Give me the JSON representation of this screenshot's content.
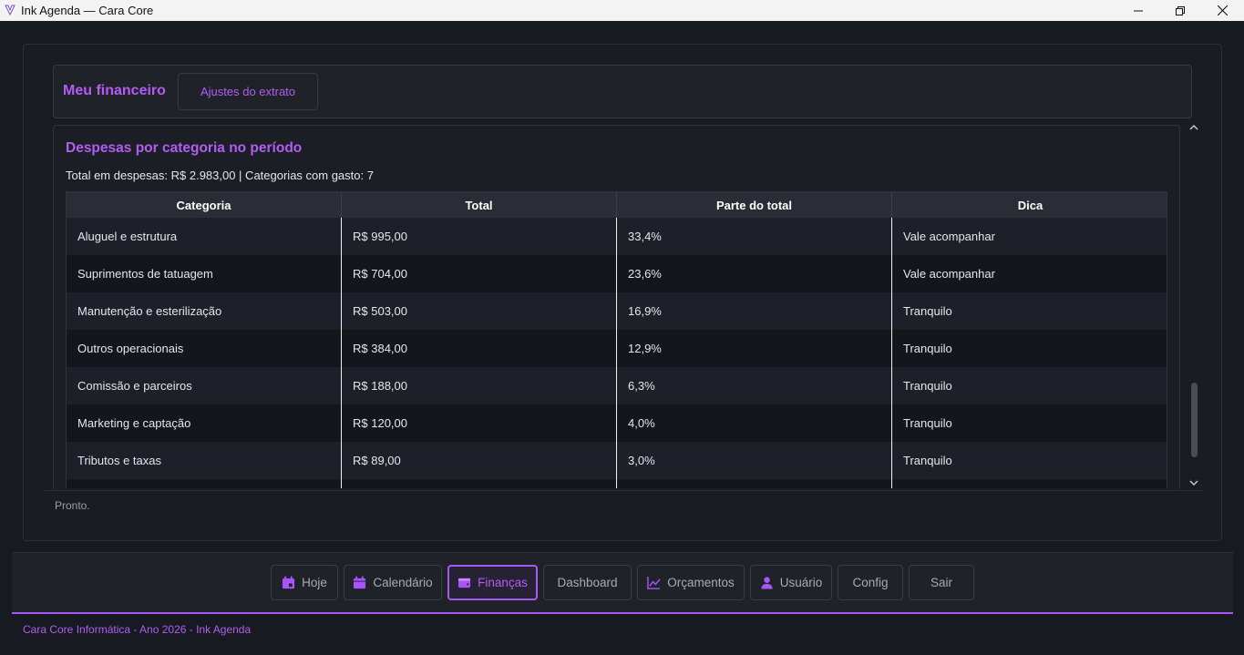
{
  "window": {
    "title": "Ink Agenda — Cara Core"
  },
  "header": {
    "brand": "Meu financeiro",
    "tab_label": "Ajustes do extrato"
  },
  "section": {
    "title": "Despesas por categoria no período",
    "summary": "Total em despesas: R$ 2.983,00 | Categorias com gasto: 7"
  },
  "table": {
    "columns": [
      "Categoria",
      "Total",
      "Parte do total",
      "Dica"
    ],
    "rows": [
      [
        "Aluguel e estrutura",
        "R$ 995,00",
        "33,4%",
        "Vale acompanhar"
      ],
      [
        "Suprimentos de tatuagem",
        "R$ 704,00",
        "23,6%",
        "Vale acompanhar"
      ],
      [
        "Manutenção e esterilização",
        "R$ 503,00",
        "16,9%",
        "Tranquilo"
      ],
      [
        "Outros operacionais",
        "R$ 384,00",
        "12,9%",
        "Tranquilo"
      ],
      [
        "Comissão e parceiros",
        "R$ 188,00",
        "6,3%",
        "Tranquilo"
      ],
      [
        "Marketing e captação",
        "R$ 120,00",
        "4,0%",
        "Tranquilo"
      ],
      [
        "Tributos e taxas",
        "R$ 89,00",
        "3,0%",
        "Tranquilo"
      ],
      [
        "",
        "",
        "",
        ""
      ]
    ]
  },
  "status": "Pronto.",
  "nav": {
    "items": [
      {
        "label": "Hoje",
        "icon": "calendar-day-icon"
      },
      {
        "label": "Calendário",
        "icon": "calendar-icon"
      },
      {
        "label": "Finanças",
        "icon": "wallet-icon",
        "active": true
      },
      {
        "label": "Dashboard",
        "icon": ""
      },
      {
        "label": "Orçamentos",
        "icon": "chart-line-icon"
      },
      {
        "label": "Usuário",
        "icon": "user-icon"
      },
      {
        "label": "Config",
        "icon": ""
      },
      {
        "label": "Sair",
        "icon": ""
      }
    ]
  },
  "footer": "Cara Core Informática - Ano 2026 - Ink Agenda",
  "colors": {
    "accent": "#a855f7",
    "background": "#171a21",
    "panel": "#1f2229"
  }
}
